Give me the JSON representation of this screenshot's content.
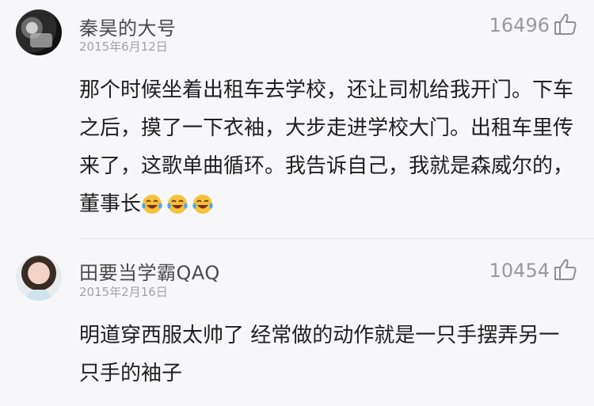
{
  "comments": [
    {
      "username": "秦昊的大号",
      "date": "2015年6月12日",
      "likes": "16496",
      "text": "那个时候坐着出租车去学校，还让司机给我开门。下车之后，摸了一下衣袖，大步走进学校大门。出租车里传来了，这歌单曲循环。我告诉自己，我就是森威尔的，董事长",
      "emoji": [
        "laughing-tears-emoji",
        "laughing-tears-emoji",
        "laughing-tears-emoji"
      ]
    },
    {
      "username": "田要当学霸QAQ",
      "date": "2015年2月16日",
      "likes": "10454",
      "text": "明道穿西服太帅了 经常做的动作就是一只手摆弄另一只手的袖子"
    }
  ],
  "icons": {
    "like": "thumbs-up-icon"
  },
  "colors": {
    "background": "#f7f7f9",
    "username": "#4a4a4a",
    "meta": "#a3a3a3",
    "text": "#1f1f1f",
    "emoji_face": "#f7c23a"
  }
}
